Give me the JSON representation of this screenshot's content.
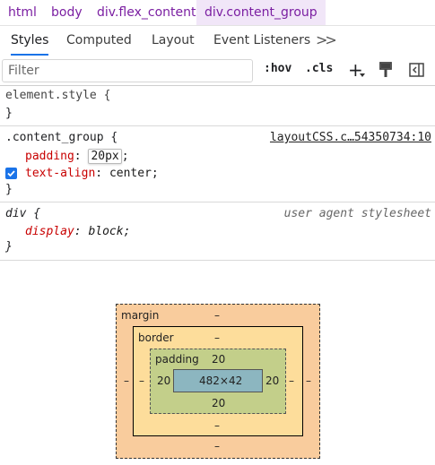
{
  "breadcrumb": [
    "html",
    "body",
    "div.flex_content",
    "div.content_group"
  ],
  "tabs": [
    "Styles",
    "Computed",
    "Layout",
    "Event Listeners"
  ],
  "more_tabs": ">>",
  "filter": {
    "placeholder": "Filter"
  },
  "toolbar": {
    "hov": ":hov",
    "cls": ".cls",
    "add": "+"
  },
  "rules": {
    "element_style": {
      "selector": "element.style {",
      "close": "}"
    },
    "content_group": {
      "selector": ".content_group {",
      "source": "layoutCSS.c…54350734:10",
      "props": [
        {
          "name": "padding",
          "value": "20px"
        },
        {
          "name": "text-align",
          "value": "center"
        }
      ],
      "close": "}"
    },
    "div": {
      "selector": "div {",
      "source": "user agent stylesheet",
      "props": [
        {
          "name": "display",
          "value": "block"
        }
      ],
      "close": "}"
    }
  },
  "box_model": {
    "margin_label": "margin",
    "margin_top": "–",
    "margin_bottom": "–",
    "margin_left": "–",
    "margin_right": "–",
    "border_label": "border",
    "border_top": "–",
    "border_bottom": "–",
    "border_left": "–",
    "border_right": "–",
    "padding_label": "padding",
    "padding_top": "20",
    "padding_bottom": "20",
    "padding_left": "20",
    "padding_right": "20",
    "content": "482×42"
  },
  "colors": {
    "accent": "#1a73e8",
    "breadcrumb": "#7b1fa2",
    "property": "#c80000",
    "margin": "#f9cc9d",
    "border": "#fddd9b",
    "padding": "#c3cf8a",
    "content": "#8cb6c0"
  }
}
